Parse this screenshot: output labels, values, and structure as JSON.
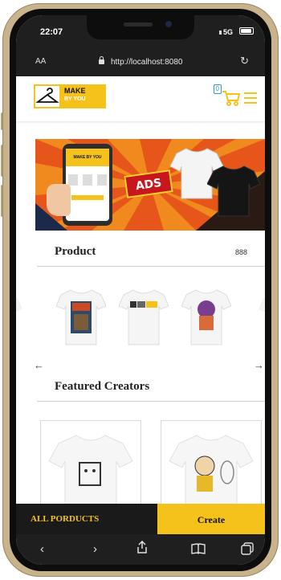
{
  "status": {
    "time": "22:07",
    "signal": "5G"
  },
  "browser": {
    "aa_label": "AA",
    "url": "http://localhost:8080"
  },
  "header": {
    "logo_line1": "MAKE",
    "logo_line2": "BY YOU",
    "cart_count": "0"
  },
  "banner": {
    "ads_label": "ADS",
    "phone_mock_title": "MAKE BY YOU"
  },
  "product_section": {
    "title": "Product",
    "grid_label": "888"
  },
  "featured_section": {
    "title": "Featured Creators"
  },
  "bottom_bar": {
    "all_products": "ALL PORDUCTS",
    "create": "Create"
  },
  "colors": {
    "brand_yellow": "#f4c21a",
    "dark": "#1a1a1a",
    "frame_gold": "#c9b38d"
  },
  "icons": [
    "hanger-icon",
    "cart-icon",
    "menu-icon",
    "lock-icon",
    "reload-icon",
    "grid-icon",
    "arrow-left-icon",
    "arrow-right-icon",
    "back-icon",
    "forward-icon",
    "share-icon",
    "bookmarks-icon",
    "tabs-icon"
  ]
}
